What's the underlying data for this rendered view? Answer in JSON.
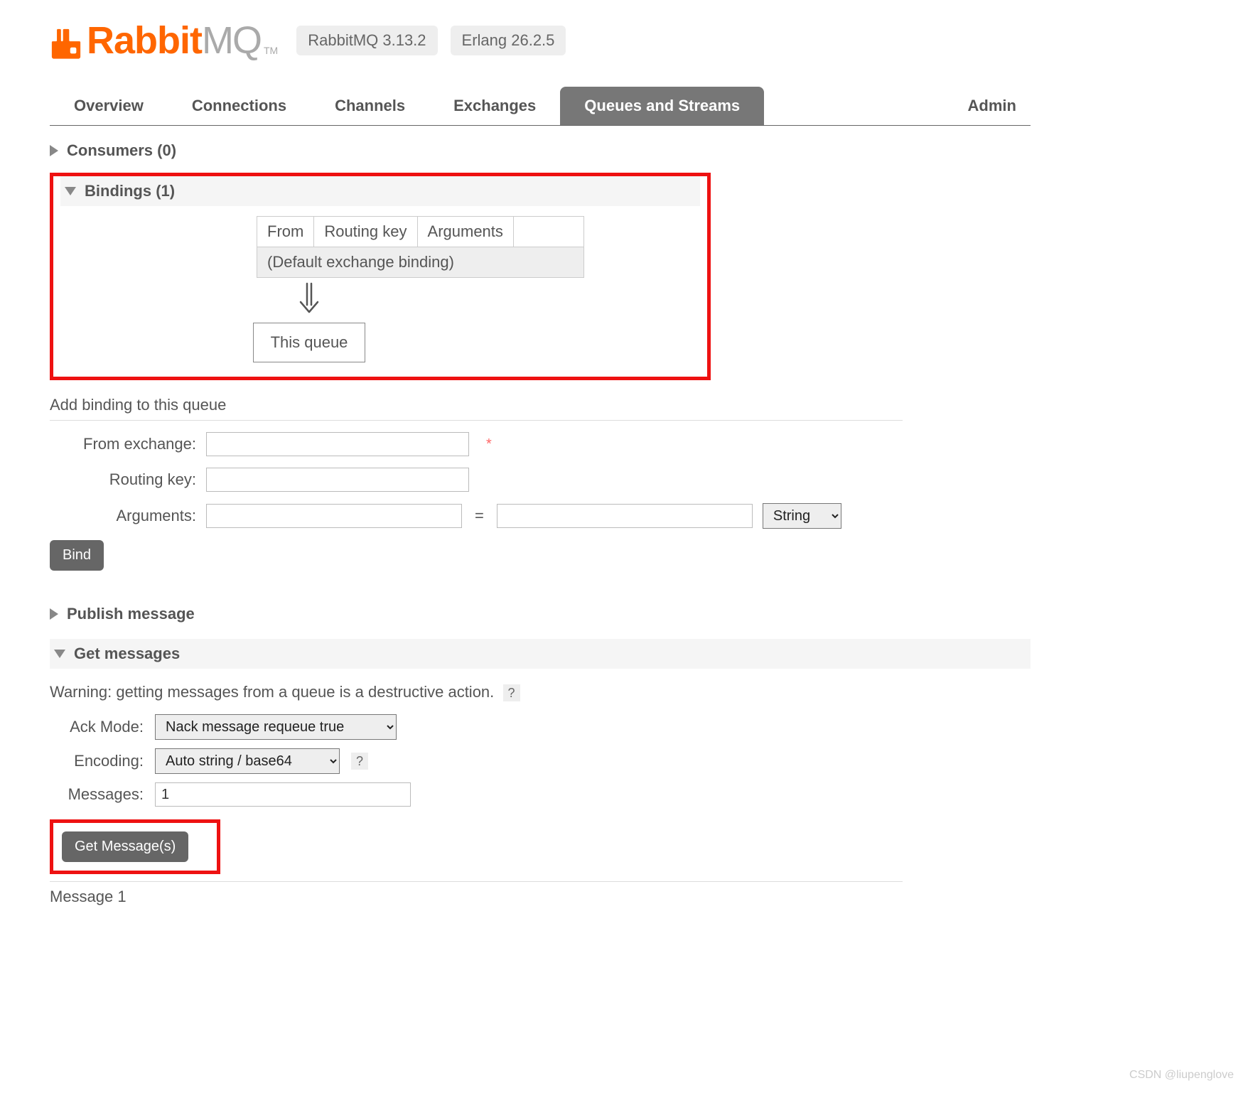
{
  "header": {
    "brand_rabbit": "Rabbit",
    "brand_mq": "MQ",
    "tm": "TM",
    "version_badge": "RabbitMQ 3.13.2",
    "erlang_badge": "Erlang 26.2.5"
  },
  "tabs": {
    "overview": "Overview",
    "connections": "Connections",
    "channels": "Channels",
    "exchanges": "Exchanges",
    "queues": "Queues and Streams",
    "admin": "Admin"
  },
  "sections": {
    "consumers": "Consumers (0)",
    "bindings": "Bindings (1)",
    "publish": "Publish message",
    "getmsg": "Get messages"
  },
  "bindings_table": {
    "h_from": "From",
    "h_rk": "Routing key",
    "h_args": "Arguments",
    "default_row": "(Default exchange binding)",
    "this_queue": "This queue"
  },
  "add_binding": {
    "title": "Add binding to this queue",
    "from_label": "From exchange:",
    "rk_label": "Routing key:",
    "args_label": "Arguments:",
    "type_option": "String",
    "bind_button": "Bind"
  },
  "get_messages": {
    "warning": "Warning: getting messages from a queue is a destructive action.",
    "ack_label": "Ack Mode:",
    "ack_option": "Nack message requeue true",
    "encoding_label": "Encoding:",
    "encoding_option": "Auto string / base64",
    "messages_label": "Messages:",
    "messages_value": "1",
    "get_button": "Get Message(s)",
    "result_header": "Message 1",
    "help": "?"
  },
  "watermark": "CSDN @liupenglove"
}
